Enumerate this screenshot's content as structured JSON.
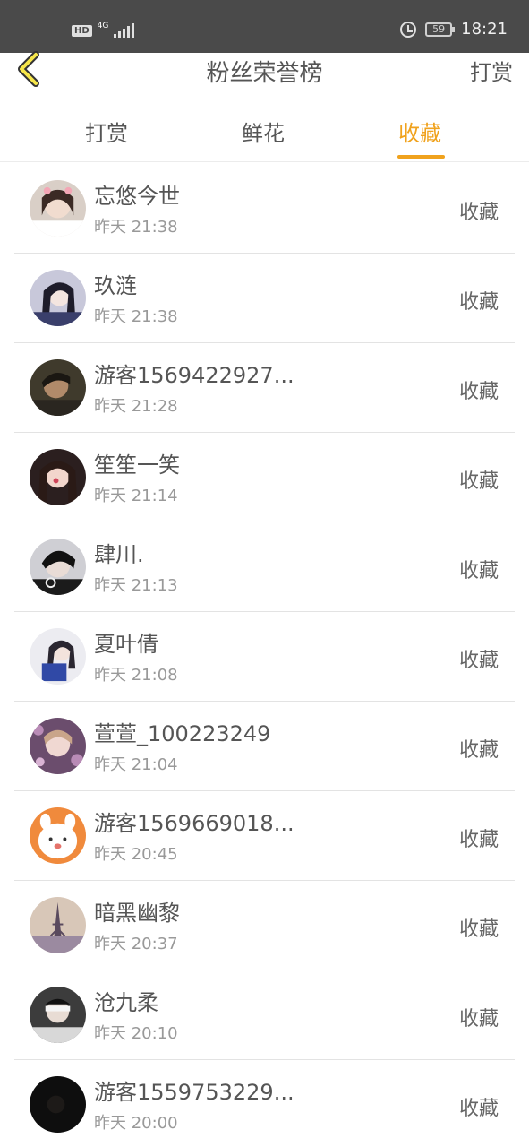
{
  "statusbar": {
    "hd": "HD",
    "network": "4G",
    "battery": "59",
    "time": "18:21"
  },
  "nav": {
    "title": "粉丝荣誉榜",
    "right": "打赏"
  },
  "tabs": [
    {
      "label": "打赏",
      "active": false
    },
    {
      "label": "鲜花",
      "active": false
    },
    {
      "label": "收藏",
      "active": true
    }
  ],
  "colors": {
    "accent": "#f0a21d",
    "back_icon_fill": "#f6e64a",
    "statusbar": "#4a4a4a"
  },
  "list": [
    {
      "name": "忘悠今世",
      "time": "昨天 21:38",
      "action": "收藏",
      "avatar": "avatar-photo"
    },
    {
      "name": "玖涟",
      "time": "昨天 21:38",
      "action": "收藏",
      "avatar": "avatar-photo"
    },
    {
      "name": "游客1569422927...",
      "time": "昨天 21:28",
      "action": "收藏",
      "avatar": "avatar-photo"
    },
    {
      "name": "笙笙一笑",
      "time": "昨天 21:14",
      "action": "收藏",
      "avatar": "avatar-photo"
    },
    {
      "name": "肆川.",
      "time": "昨天 21:13",
      "action": "收藏",
      "avatar": "avatar-photo"
    },
    {
      "name": "夏叶倩",
      "time": "昨天 21:08",
      "action": "收藏",
      "avatar": "avatar-photo"
    },
    {
      "name": "萱萱_100223249",
      "time": "昨天 21:04",
      "action": "收藏",
      "avatar": "avatar-photo"
    },
    {
      "name": "游客1569669018...",
      "time": "昨天 20:45",
      "action": "收藏",
      "avatar": "avatar-cartoon"
    },
    {
      "name": "暗黑幽黎",
      "time": "昨天 20:37",
      "action": "收藏",
      "avatar": "avatar-eiffel"
    },
    {
      "name": "沧九柔",
      "time": "昨天 20:10",
      "action": "收藏",
      "avatar": "avatar-photo"
    },
    {
      "name": "游客1559753229...",
      "time": "昨天 20:00",
      "action": "收藏",
      "avatar": "avatar-dark"
    }
  ]
}
